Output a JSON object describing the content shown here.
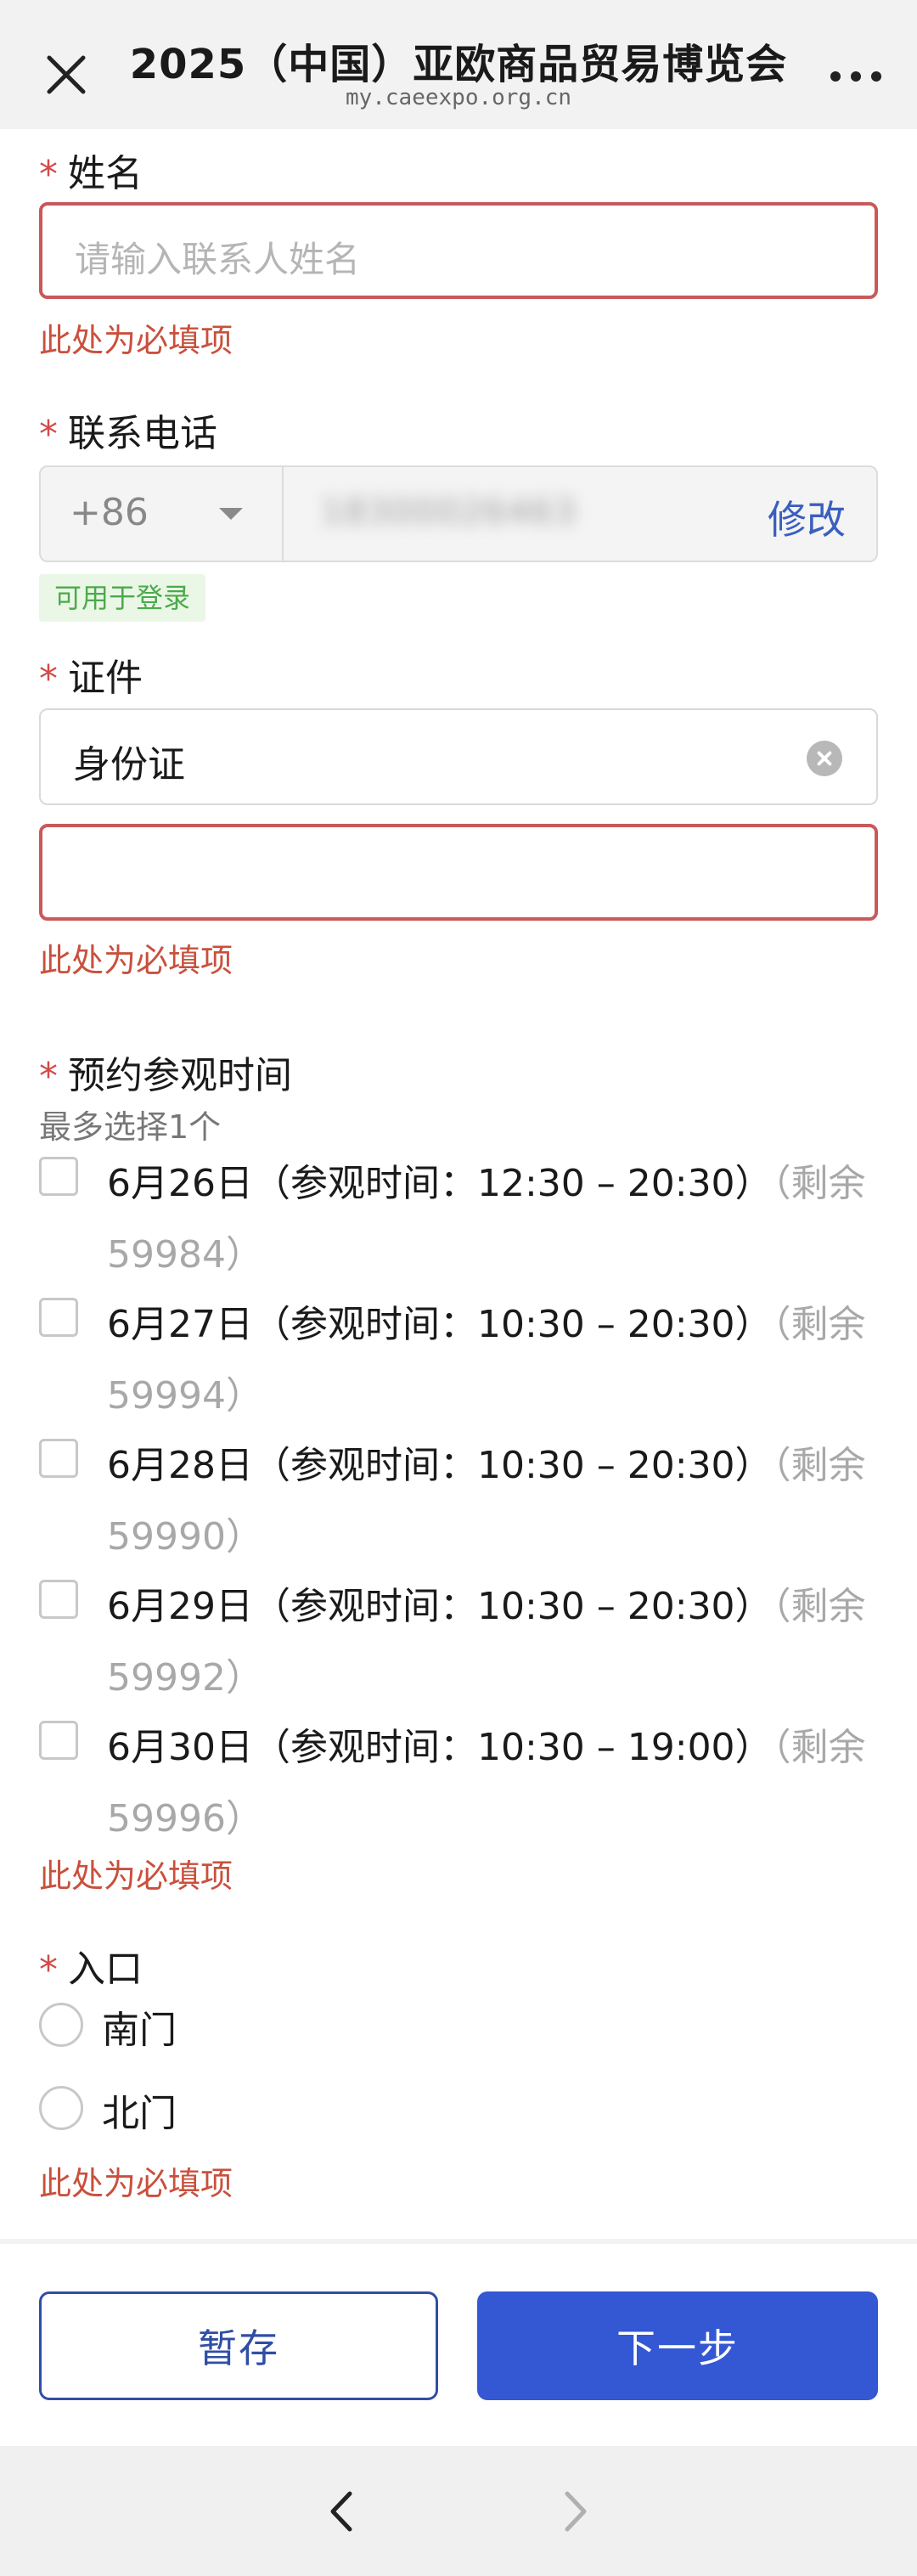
{
  "header": {
    "title": "2025（中国）亚欧商品贸易博览会",
    "subtitle": "my.caeexpo.org.cn",
    "close_icon": "close-icon",
    "more_icon": "more-icon"
  },
  "form": {
    "required_mark": "*",
    "name": {
      "label": "姓名",
      "placeholder": "请输入联系人姓名",
      "value": "",
      "error": "此处为必填项"
    },
    "phone": {
      "label": "联系电话",
      "country_code": "+86",
      "number": "18300026463",
      "modify_label": "修改",
      "badge": "可用于登录"
    },
    "id": {
      "label": "证件",
      "type_value": "身份证",
      "number_value": "",
      "error": "此处为必填项"
    },
    "visit_time": {
      "label": "预约参观时间",
      "hint": "最多选择1个",
      "options": [
        {
          "text": "6月26日（参观时间：12:30 – 20:30）",
          "remain": "（剩余 59984）",
          "checked": false
        },
        {
          "text": "6月27日（参观时间：10:30 – 20:30）",
          "remain": "（剩余 59994）",
          "checked": false
        },
        {
          "text": "6月28日（参观时间：10:30 – 20:30）",
          "remain": "（剩余 59990）",
          "checked": false
        },
        {
          "text": "6月29日（参观时间：10:30 – 20:30）",
          "remain": "（剩余 59992）",
          "checked": false
        },
        {
          "text": "6月30日（参观时间：10:30 – 19:00）",
          "remain": "（剩余 59996）",
          "checked": false
        }
      ],
      "error": "此处为必填项"
    },
    "entrance": {
      "label": "入口",
      "options": [
        {
          "label": "南门",
          "checked": false
        },
        {
          "label": "北门",
          "checked": false
        }
      ],
      "error": "此处为必填项"
    }
  },
  "actions": {
    "save_label": "暂存",
    "next_label": "下一步"
  },
  "browser_nav": {
    "back_icon": "chevron-left-icon",
    "forward_icon": "chevron-right-icon"
  },
  "colors": {
    "primary": "#3458d3",
    "error": "#c9503c",
    "badge_text": "#4caa4c",
    "badge_bg": "#eaf7e6"
  }
}
